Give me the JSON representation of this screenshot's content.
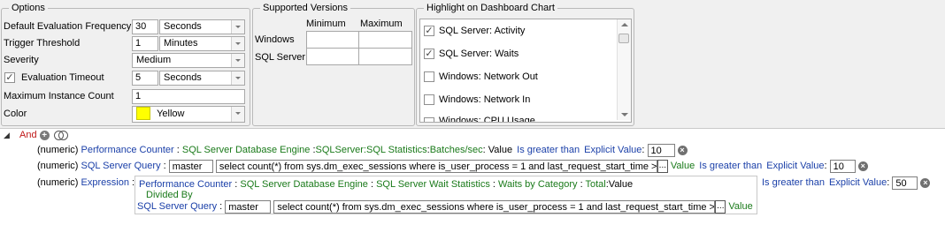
{
  "options": {
    "legend": "Options",
    "default_eval_frequency": {
      "label": "Default Evaluation Frequency",
      "value": "30",
      "unit": "Seconds"
    },
    "trigger_threshold": {
      "label": "Trigger Threshold",
      "value": "1",
      "unit": "Minutes"
    },
    "severity": {
      "label": "Severity",
      "value": "Medium"
    },
    "evaluation_timeout": {
      "label": "Evaluation Timeout",
      "checked": true,
      "value": "5",
      "unit": "Seconds"
    },
    "max_instance_count": {
      "label": "Maximum Instance Count",
      "value": "1"
    },
    "color": {
      "label": "Color",
      "value": "Yellow",
      "swatch": "#ffff00"
    }
  },
  "supported_versions": {
    "legend": "Supported Versions",
    "col_min": "Minimum",
    "col_max": "Maximum",
    "rows": [
      "Windows",
      "SQL Server"
    ]
  },
  "highlight": {
    "legend": "Highlight on Dashboard Chart",
    "items": [
      {
        "label": "SQL Server: Activity",
        "checked": true
      },
      {
        "label": "SQL Server: Waits",
        "checked": true
      },
      {
        "label": "Windows: Network Out",
        "checked": false
      },
      {
        "label": "Windows: Network In",
        "checked": false
      },
      {
        "label": "Windows: CPU Usage",
        "checked": false
      }
    ]
  },
  "condition_tree": {
    "root_label": "And",
    "row1": {
      "type": "(numeric)",
      "source": "Performance Counter",
      "sep": ":",
      "object": "SQL Server Database Engine",
      "counter": "SQLServer:SQL Statistics",
      "instance": "Batches/sec",
      "value_label": "Value",
      "operator": "Is greater than",
      "explicit": "Explicit Value",
      "threshold": "10"
    },
    "row2": {
      "type": "(numeric)",
      "source": "SQL Server Query",
      "sep": ":",
      "db": "master",
      "query": "select count(*) from sys.dm_exec_sessions where is_user_process = 1 and last_request_start_time >",
      "dots": "...",
      "value_label": "Value",
      "operator": "Is greater than",
      "explicit": "Explicit Value",
      "threshold": "10"
    },
    "row3": {
      "type": "(numeric)",
      "source": "Expression",
      "sep": ":",
      "expr_source": "Performance Counter",
      "expr_object": "SQL Server Database Engine",
      "expr_counter": "SQL Server Wait Statistics",
      "expr_instance": "Waits by Category",
      "expr_total": "Total",
      "expr_value": "Value",
      "divided_by": "Divided By",
      "q_source": "SQL Server Query",
      "q_db": "master",
      "q_query": "select count(*) from sys.dm_exec_sessions where is_user_process = 1 and last_request_start_time >",
      "dots": "...",
      "q_value": "Value",
      "operator": "Is greater than",
      "explicit": "Explicit Value",
      "threshold": "50"
    }
  }
}
